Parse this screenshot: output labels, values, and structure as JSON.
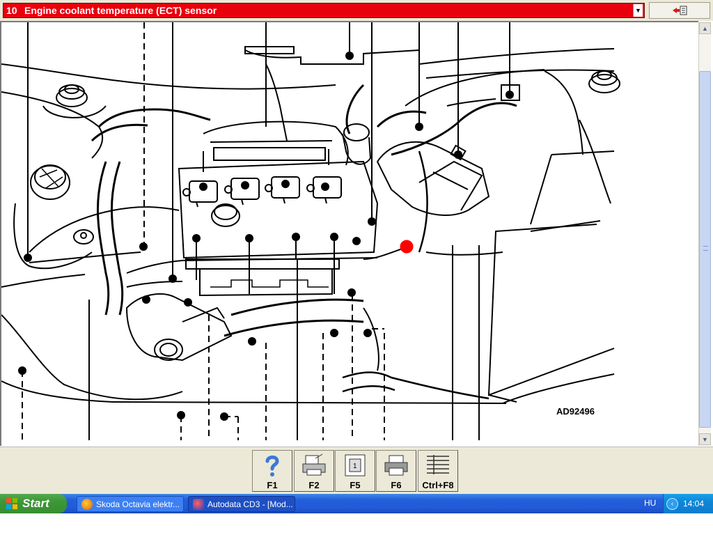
{
  "selector": {
    "number": "10",
    "title": "Engine coolant temperature (ECT) sensor",
    "dropdown_icon": "chevron-down-icon"
  },
  "exit_button": {
    "icon": "exit-door-icon"
  },
  "diagram": {
    "reference_code": "AD92496",
    "highlight_color": "#ff0000",
    "highlight_component": "Engine coolant temperature (ECT) sensor"
  },
  "function_keys": [
    {
      "label": "F1",
      "icon": "help-question-icon"
    },
    {
      "label": "F2",
      "icon": "print-setup-icon"
    },
    {
      "label": "F5",
      "icon": "component-info-icon"
    },
    {
      "label": "F6",
      "icon": "printer-icon"
    },
    {
      "label": "Ctrl+F8",
      "icon": "list-table-icon"
    }
  ],
  "taskbar": {
    "start_label": "Start",
    "tasks": [
      {
        "label": "Skoda Octavia elektr...",
        "icon": "firefox-icon",
        "active": false
      },
      {
        "label": "Autodata CD3 - [Mod...",
        "icon": "autodata-icon",
        "active": true
      }
    ],
    "language": "HU",
    "clock": "14:04"
  },
  "colors": {
    "selector_bar": "#e8000c",
    "taskbar": "#245edc",
    "start_button": "#3d9637",
    "tray": "#0f86d6"
  }
}
